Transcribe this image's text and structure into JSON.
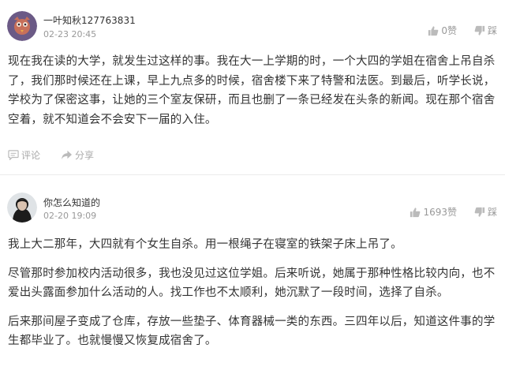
{
  "comments": [
    {
      "username": "一叶知秋127763831",
      "time": "02-23 20:45",
      "like_label": "0赞",
      "dislike_label": "踩",
      "paragraphs": [
        "现在我在读的大学，就发生过这样的事。我在大一上学期的时，一个大四的学姐在宿舍上吊自杀了，我们那时候还在上课，早上九点多的时候，宿舍楼下来了特警和法医。到最后，听学长说，学校为了保密这事，让她的三个室友保研，而且也删了一条已经发在头条的新闻。现在那个宿舍空着，就不知道会不会安下一届的入住。"
      ],
      "comment_label": "评论",
      "share_label": "分享"
    },
    {
      "username": "你怎么知道的",
      "time": "02-20 19:09",
      "like_label": "1693赞",
      "dislike_label": "踩",
      "paragraphs": [
        "我上大二那年，大四就有个女生自杀。用一根绳子在寝室的铁架子床上吊了。",
        "尽管那时参加校内活动很多，我也没见过这位学姐。后来听说，她属于那种性格比较内向，也不爱出头露面参加什么活动的人。找工作也不太顺利，她沉默了一段时间，选择了自杀。",
        "后来那间屋子变成了仓库，存放一些垫子、体育器械一类的东西。三四年以后，知道这件事的学生都毕业了。也就慢慢又恢复成宿舍了。"
      ]
    }
  ]
}
